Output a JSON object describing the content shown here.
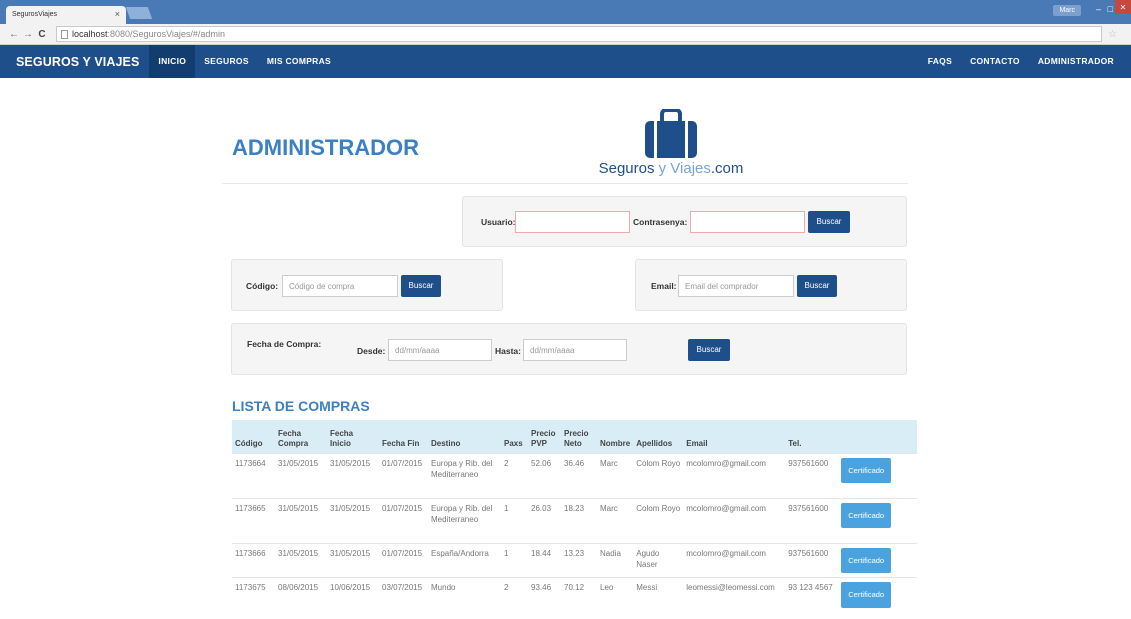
{
  "browser": {
    "tab_title": "SegurosViajes",
    "tab_close": "×",
    "user_badge": "Marc",
    "url_host": "localhost",
    "url_rest": ":8080/SegurosViajes/#/admin",
    "back": "←",
    "forward": "→",
    "reload": "C",
    "star": "☆",
    "min": "–",
    "max": "□",
    "close": "✕"
  },
  "navbar": {
    "brand": "SEGUROS Y VIAJES",
    "left_items": [
      "INICIO",
      "SEGUROS",
      "MIS COMPRAS"
    ],
    "right_items": [
      "FAQS",
      "CONTACTO",
      "ADMINISTRADOR"
    ]
  },
  "header": {
    "title": "ADMINISTRADOR",
    "logo_dark1": "Seguros",
    "logo_light": " y Viajes",
    "logo_dark2": ".com"
  },
  "login": {
    "user_label": "Usuario:",
    "pass_label": "Contrasenya:",
    "button": "Buscar"
  },
  "code_search": {
    "label": "Código:",
    "placeholder": "Código de compra",
    "button": "Buscar"
  },
  "email_search": {
    "label": "Email:",
    "placeholder": "Email del comprador",
    "button": "Buscar"
  },
  "date_search": {
    "label": "Fecha de Compra:",
    "from_label": "Desde:",
    "from_placeholder": "dd/mm/aaaa",
    "to_label": "Hasta:",
    "to_placeholder": "dd/mm/aaaa",
    "button": "Buscar"
  },
  "list": {
    "title": "LISTA DE COMPRAS",
    "headers": [
      "Código",
      "Fecha Compra",
      "Fecha Inicio",
      "Fecha Fin",
      "Destino",
      "Paxs",
      "Precio PVP",
      "Precio Neto",
      "Nombre",
      "Apellidos",
      "Email",
      "Tel.",
      ""
    ],
    "button": "Certificado",
    "rows": [
      [
        "1173664",
        "31/05/2015",
        "31/05/2015",
        "01/07/2015",
        "Europa y Rib. del Mediterraneo",
        "2",
        "52.06",
        "36.46",
        "Marc",
        "Colom Royo",
        "mcolomro@gmail.com",
        "937561600"
      ],
      [
        "1173665",
        "31/05/2015",
        "31/05/2015",
        "01/07/2015",
        "Europa y Rib. del Mediterraneo",
        "1",
        "26.03",
        "18.23",
        "Marc",
        "Colom Royo",
        "mcolomro@gmail.com",
        "937561600"
      ],
      [
        "1173666",
        "31/05/2015",
        "31/05/2015",
        "01/07/2015",
        "España/Andorra",
        "1",
        "18.44",
        "13.23",
        "Nadia",
        "Agudo Naser",
        "mcolomro@gmail.com",
        "937561600"
      ],
      [
        "1173675",
        "08/06/2015",
        "10/06/2015",
        "03/07/2015",
        "Mundo",
        "2",
        "93.46",
        "70.12",
        "Leo",
        "Messi",
        "leomessi@leomessi.com",
        "93 123 4567"
      ]
    ]
  }
}
